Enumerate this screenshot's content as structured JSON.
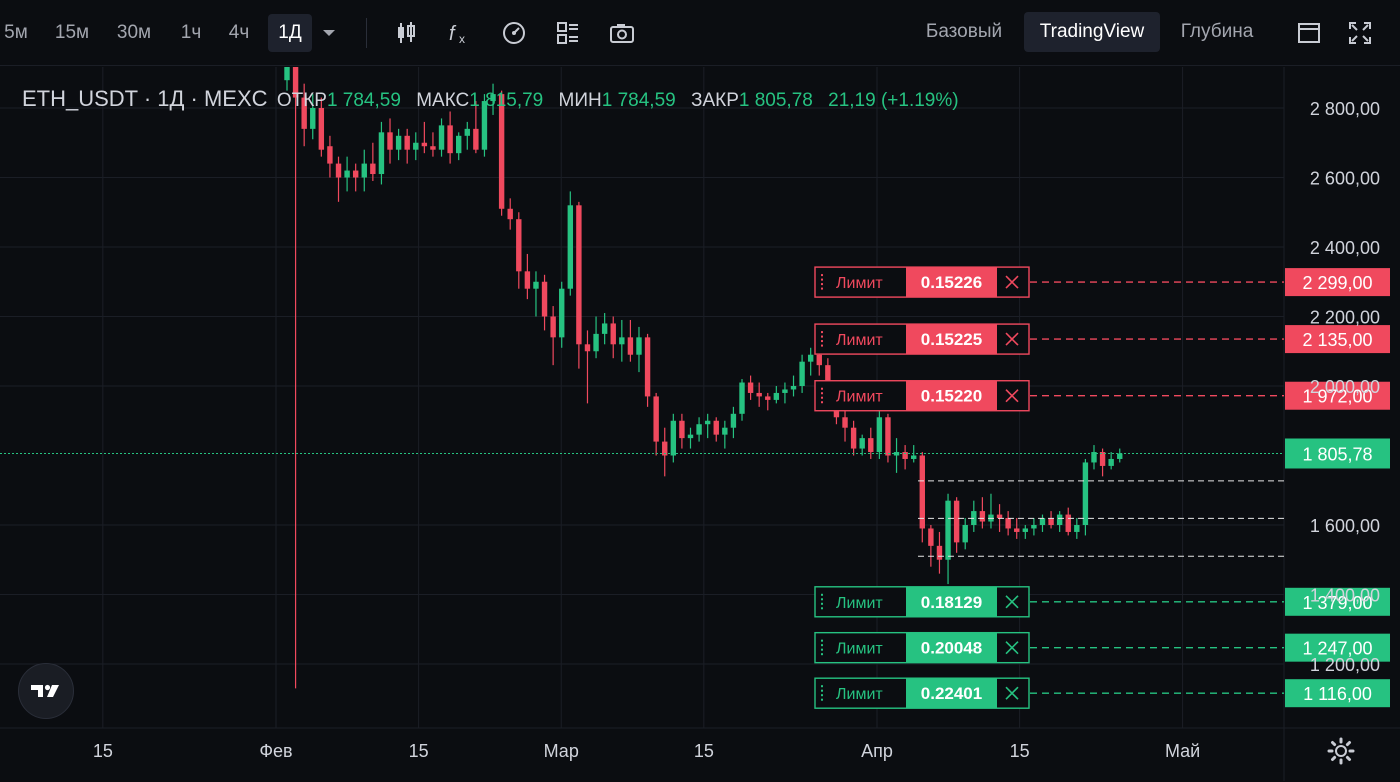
{
  "toolbar": {
    "timeframes": [
      "5м",
      "15м",
      "30м",
      "1ч",
      "4ч",
      "1Д"
    ],
    "active_timeframe": "1Д",
    "icons": [
      "candles-icon",
      "indicators-fx-icon",
      "speedometer-icon",
      "layout-grid-icon",
      "camera-icon"
    ],
    "views": [
      "Базовый",
      "TradingView",
      "Глубина"
    ],
    "active_view": "TradingView",
    "right_icons": [
      "window-icon",
      "fullscreen-icon"
    ]
  },
  "legend": {
    "symbol": "ETH_USDT · 1Д · MEXC",
    "open_label": "ОТКР",
    "open": "1 784,59",
    "high_label": "МАКС",
    "high": "1 815,79",
    "low_label": "МИН",
    "low": "1 784,59",
    "close_label": "ЗАКР",
    "close": "1 805,78",
    "change": "21,19 (+1.19%)"
  },
  "colors": {
    "up": "#26c281",
    "down": "#f0495e",
    "background": "#0b0d11",
    "grid": "#1b1e26",
    "text": "#d1d4dc",
    "muted": "#a3a6af"
  },
  "chart_data": {
    "type": "candlestick",
    "price_axis": {
      "ticks": [
        2800,
        2600,
        2400,
        2200,
        2000,
        1600,
        1400,
        1200
      ],
      "tick_labels": [
        "2 800,00",
        "2 600,00",
        "2 400,00",
        "2 200,00",
        "2 000,00",
        "1 600,00",
        "1 400,00",
        "1 200,00"
      ],
      "range": [
        1030,
        2900
      ]
    },
    "time_axis": {
      "labels": [
        "15",
        "Фев",
        "15",
        "Мар",
        "15",
        "Апр",
        "15",
        "Май"
      ],
      "dates": [
        "2023-01-15",
        "2023-02-01",
        "2023-02-15",
        "2023-03-01",
        "2023-03-15",
        "2023-04-01",
        "2023-04-15",
        "2023-05-01"
      ]
    },
    "current_price": {
      "value": 1805.78,
      "label": "1 805,78"
    },
    "ohlc": [
      [
        2880,
        2960,
        2850,
        2920
      ],
      [
        2930,
        2950,
        1130,
        2830
      ],
      [
        2830,
        2870,
        2690,
        2740
      ],
      [
        2740,
        2840,
        2710,
        2800
      ],
      [
        2800,
        2830,
        2660,
        2680
      ],
      [
        2690,
        2720,
        2600,
        2640
      ],
      [
        2640,
        2660,
        2530,
        2600
      ],
      [
        2600,
        2660,
        2560,
        2620
      ],
      [
        2620,
        2640,
        2560,
        2600
      ],
      [
        2600,
        2680,
        2560,
        2640
      ],
      [
        2640,
        2700,
        2590,
        2610
      ],
      [
        2610,
        2760,
        2580,
        2730
      ],
      [
        2730,
        2770,
        2640,
        2680
      ],
      [
        2680,
        2740,
        2650,
        2720
      ],
      [
        2720,
        2740,
        2640,
        2680
      ],
      [
        2680,
        2730,
        2650,
        2700
      ],
      [
        2700,
        2760,
        2670,
        2690
      ],
      [
        2690,
        2730,
        2660,
        2680
      ],
      [
        2680,
        2770,
        2660,
        2750
      ],
      [
        2750,
        2790,
        2640,
        2670
      ],
      [
        2670,
        2730,
        2650,
        2720
      ],
      [
        2720,
        2760,
        2680,
        2740
      ],
      [
        2740,
        2820,
        2670,
        2680
      ],
      [
        2680,
        2840,
        2660,
        2820
      ],
      [
        2820,
        2870,
        2780,
        2840
      ],
      [
        2840,
        2850,
        2490,
        2510
      ],
      [
        2510,
        2540,
        2450,
        2480
      ],
      [
        2480,
        2500,
        2280,
        2330
      ],
      [
        2330,
        2380,
        2250,
        2280
      ],
      [
        2280,
        2330,
        2200,
        2300
      ],
      [
        2300,
        2320,
        2160,
        2200
      ],
      [
        2200,
        2230,
        2060,
        2140
      ],
      [
        2140,
        2300,
        2110,
        2280
      ],
      [
        2280,
        2560,
        2260,
        2520
      ],
      [
        2520,
        2530,
        2050,
        2120
      ],
      [
        2120,
        2160,
        1950,
        2100
      ],
      [
        2100,
        2200,
        2080,
        2150
      ],
      [
        2150,
        2210,
        2120,
        2180
      ],
      [
        2180,
        2200,
        2080,
        2120
      ],
      [
        2120,
        2190,
        2070,
        2140
      ],
      [
        2140,
        2190,
        2070,
        2090
      ],
      [
        2090,
        2170,
        2040,
        2140
      ],
      [
        2140,
        2150,
        1940,
        1970
      ],
      [
        1970,
        1980,
        1800,
        1840
      ],
      [
        1840,
        1880,
        1740,
        1800
      ],
      [
        1800,
        1920,
        1780,
        1900
      ],
      [
        1900,
        1920,
        1820,
        1850
      ],
      [
        1850,
        1880,
        1820,
        1860
      ],
      [
        1860,
        1910,
        1840,
        1890
      ],
      [
        1890,
        1920,
        1850,
        1900
      ],
      [
        1900,
        1910,
        1840,
        1860
      ],
      [
        1860,
        1900,
        1820,
        1880
      ],
      [
        1880,
        1940,
        1850,
        1920
      ],
      [
        1920,
        2020,
        1900,
        2010
      ],
      [
        2010,
        2030,
        1960,
        1980
      ],
      [
        1980,
        2010,
        1940,
        1970
      ],
      [
        1970,
        1980,
        1930,
        1960
      ],
      [
        1960,
        2000,
        1950,
        1980
      ],
      [
        1980,
        2010,
        1950,
        1990
      ],
      [
        1990,
        2030,
        1970,
        2000
      ],
      [
        2000,
        2090,
        1980,
        2070
      ],
      [
        2070,
        2110,
        2030,
        2090
      ],
      [
        2090,
        2110,
        2030,
        2060
      ],
      [
        2060,
        2080,
        1970,
        1990
      ],
      [
        1990,
        2000,
        1890,
        1910
      ],
      [
        1910,
        1940,
        1840,
        1880
      ],
      [
        1880,
        1900,
        1800,
        1820
      ],
      [
        1820,
        1860,
        1800,
        1850
      ],
      [
        1850,
        1880,
        1790,
        1810
      ],
      [
        1810,
        1930,
        1790,
        1910
      ],
      [
        1910,
        1920,
        1780,
        1800
      ],
      [
        1800,
        1850,
        1750,
        1810
      ],
      [
        1810,
        1830,
        1760,
        1790
      ],
      [
        1790,
        1830,
        1780,
        1800
      ],
      [
        1800,
        1810,
        1550,
        1590
      ],
      [
        1590,
        1600,
        1480,
        1540
      ],
      [
        1540,
        1580,
        1460,
        1500
      ],
      [
        1500,
        1690,
        1430,
        1670
      ],
      [
        1670,
        1680,
        1520,
        1550
      ],
      [
        1550,
        1620,
        1530,
        1600
      ],
      [
        1600,
        1670,
        1580,
        1640
      ],
      [
        1640,
        1680,
        1590,
        1610
      ],
      [
        1610,
        1690,
        1590,
        1630
      ],
      [
        1630,
        1660,
        1580,
        1620
      ],
      [
        1620,
        1640,
        1570,
        1590
      ],
      [
        1590,
        1620,
        1560,
        1580
      ],
      [
        1580,
        1600,
        1560,
        1590
      ],
      [
        1590,
        1620,
        1570,
        1600
      ],
      [
        1600,
        1630,
        1580,
        1620
      ],
      [
        1620,
        1640,
        1590,
        1600
      ],
      [
        1600,
        1640,
        1580,
        1630
      ],
      [
        1630,
        1650,
        1570,
        1580
      ],
      [
        1580,
        1620,
        1560,
        1600
      ],
      [
        1600,
        1790,
        1570,
        1780
      ],
      [
        1780,
        1830,
        1760,
        1810
      ],
      [
        1810,
        1820,
        1740,
        1770
      ],
      [
        1770,
        1810,
        1760,
        1790
      ],
      [
        1790,
        1820,
        1780,
        1805.78
      ]
    ],
    "dashed_levels": [
      1727,
      1619,
      1510
    ],
    "limit_orders": [
      {
        "side": "sell",
        "type_label": "Лимит",
        "qty": "0.15226",
        "price": 2299,
        "price_label": "2 299,00"
      },
      {
        "side": "sell",
        "type_label": "Лимит",
        "qty": "0.15225",
        "price": 2135,
        "price_label": "2 135,00"
      },
      {
        "side": "sell",
        "type_label": "Лимит",
        "qty": "0.15220",
        "price": 1972,
        "price_label": "1 972,00"
      },
      {
        "side": "buy",
        "type_label": "Лимит",
        "qty": "0.18129",
        "price": 1379,
        "price_label": "1 379,00"
      },
      {
        "side": "buy",
        "type_label": "Лимит",
        "qty": "0.20048",
        "price": 1247,
        "price_label": "1 247,00"
      },
      {
        "side": "buy",
        "type_label": "Лимит",
        "qty": "0.22401",
        "price": 1116,
        "price_label": "1 116,00"
      }
    ]
  }
}
